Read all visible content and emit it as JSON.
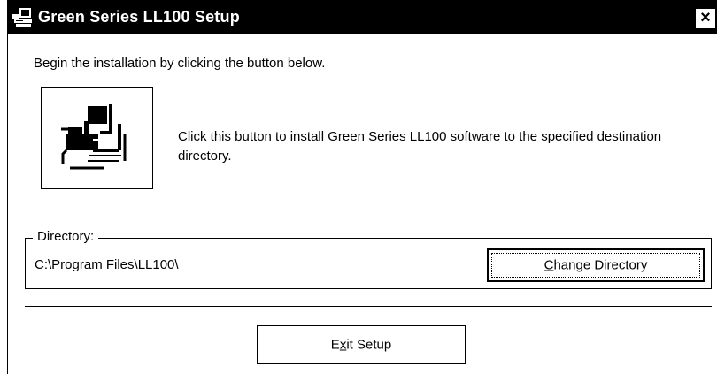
{
  "window": {
    "title": "Green Series LL100 Setup",
    "icon": "setup-computer-icon",
    "close_label": "×"
  },
  "intro_text": "Begin the installation by clicking the button below.",
  "install": {
    "icon": "setup-computer-icon",
    "description": "Click this button to install Green Series LL100 software to the specified destination directory."
  },
  "directory": {
    "legend": "Directory:",
    "path": "C:\\Program Files\\LL100\\",
    "change_button": {
      "before": "",
      "mnemonic": "C",
      "after": "hange Directory"
    }
  },
  "exit_button": {
    "before": "E",
    "mnemonic": "x",
    "after": "it Setup"
  }
}
